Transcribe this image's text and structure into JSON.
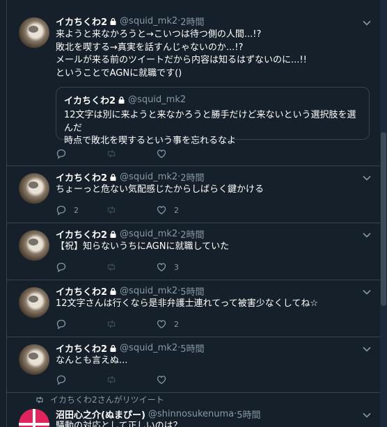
{
  "tweets": [
    {
      "name": "イカちくわ2",
      "handle": "@squid_mk2",
      "sep": " · ",
      "time": "2時間",
      "lines": [
        "来ようと来なかろうと→こいつは待つ側の人間...!?",
        "敗北を喫する→真実を話すんじゃないのか...!?",
        "メールが来る前のツイートだから内容は知るはずないのに...!!",
        "ということでAGNに就職です()"
      ],
      "quote": {
        "name": "イカちくわ2",
        "handle": "@squid_mk2",
        "lines": [
          "12文字は別に来ようと来なかろうと勝手だけど来ないという選択肢を選んだ",
          "時点で敗北を喫するという事を忘れるなよ"
        ]
      },
      "reply_count": "",
      "like_count": ""
    },
    {
      "name": "イカちくわ2",
      "handle": "@squid_mk2",
      "sep": " · ",
      "time": "2時間",
      "lines": [
        "ちょーっと危ない気配感じたからしばらく鍵かける"
      ],
      "reply_count": "2",
      "like_count": "2"
    },
    {
      "name": "イカちくわ2",
      "handle": "@squid_mk2",
      "sep": " · ",
      "time": "2時間",
      "lines": [
        "【祝】知らないうちにAGNに就職していた"
      ],
      "reply_count": "",
      "like_count": "3"
    },
    {
      "name": "イカちくわ2",
      "handle": "@squid_mk2",
      "sep": " · ",
      "time": "5時間",
      "lines": [
        "12文字さんは行くなら是非弁護士連れてって被害少なくしてね☆"
      ],
      "reply_count": "",
      "like_count": "2"
    },
    {
      "name": "イカちくわ2",
      "handle": "@squid_mk2",
      "sep": " · ",
      "time": "5時間",
      "lines": [
        "なんとも言えぬ..."
      ],
      "reply_count": "",
      "like_count": ""
    }
  ],
  "retweet": {
    "label": "イカちくわ2さんがリツイート",
    "name": "沼田心之介(ぬまぴー)",
    "handle": "@shinnosukenuma",
    "sep": " · ",
    "time": "5時間",
    "text": "騒動の対応として正しいのは？"
  },
  "icons": {
    "reply": "reply-icon",
    "retweet": "retweet-icon",
    "like": "like-icon",
    "lock": "lock-icon",
    "more": "chevron-down-icon"
  },
  "colors": {
    "background": "#15202b",
    "border": "#38444d",
    "muted": "#8899a6",
    "text": "#ffffff"
  }
}
